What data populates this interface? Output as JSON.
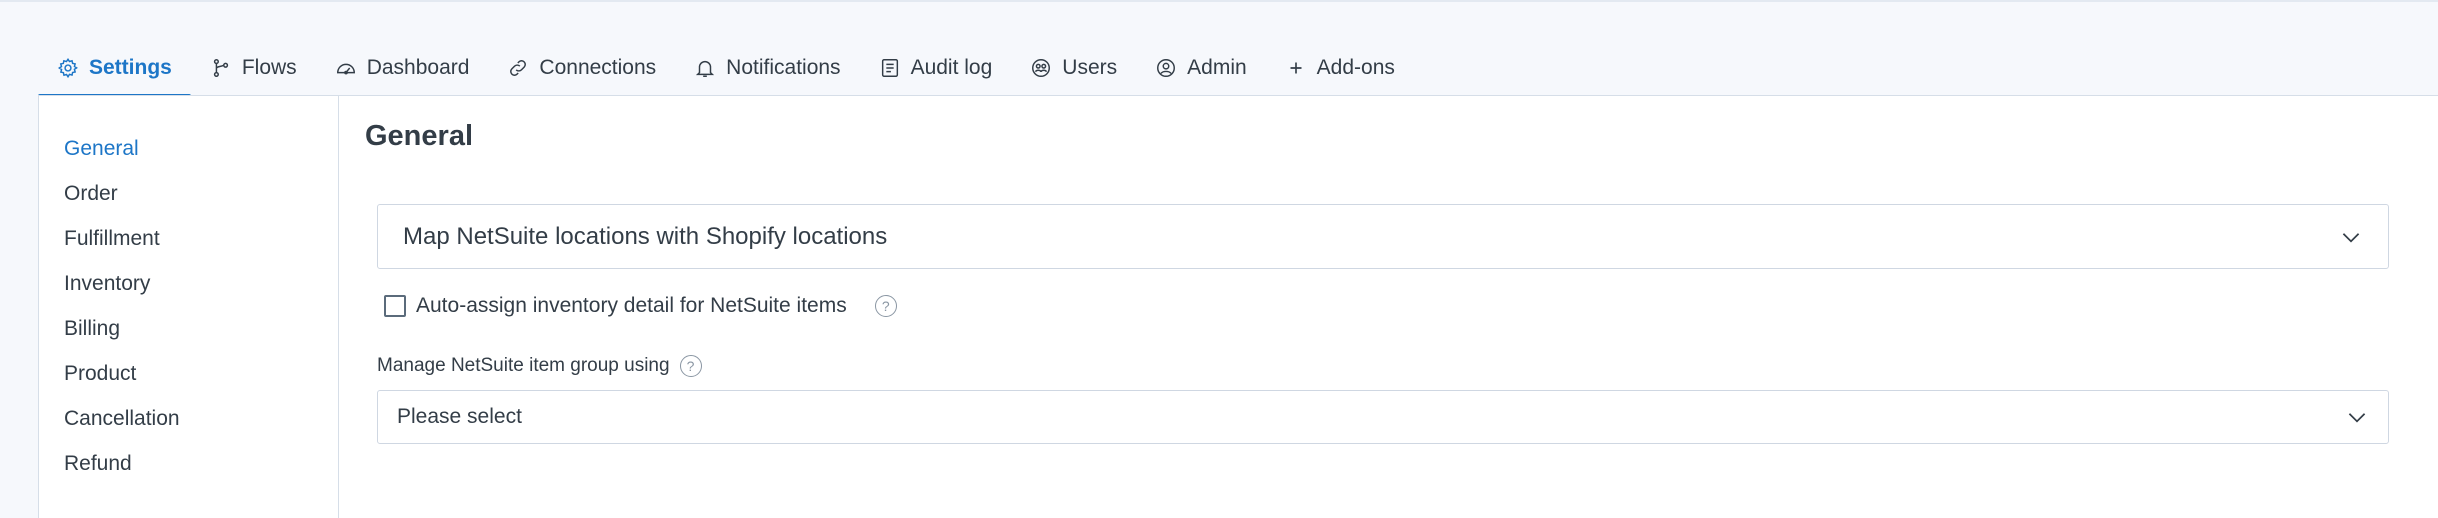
{
  "tabs": [
    {
      "label": "Settings",
      "icon": "gear-icon",
      "active": true
    },
    {
      "label": "Flows",
      "icon": "flow-icon",
      "active": false
    },
    {
      "label": "Dashboard",
      "icon": "dashboard-icon",
      "active": false
    },
    {
      "label": "Connections",
      "icon": "link-icon",
      "active": false
    },
    {
      "label": "Notifications",
      "icon": "bell-icon",
      "active": false
    },
    {
      "label": "Audit log",
      "icon": "audit-log-icon",
      "active": false
    },
    {
      "label": "Users",
      "icon": "users-icon",
      "active": false
    },
    {
      "label": "Admin",
      "icon": "admin-user-icon",
      "active": false
    },
    {
      "label": "Add-ons",
      "icon": "plus-icon",
      "active": false
    }
  ],
  "sidebar": {
    "items": [
      {
        "label": "General",
        "active": true
      },
      {
        "label": "Order",
        "active": false
      },
      {
        "label": "Fulfillment",
        "active": false
      },
      {
        "label": "Inventory",
        "active": false
      },
      {
        "label": "Billing",
        "active": false
      },
      {
        "label": "Product",
        "active": false
      },
      {
        "label": "Cancellation",
        "active": false
      },
      {
        "label": "Refund",
        "active": false
      }
    ]
  },
  "main": {
    "title": "General",
    "accordion": {
      "label": "Map NetSuite locations with Shopify locations"
    },
    "auto_assign": {
      "label": "Auto-assign inventory detail for NetSuite items",
      "checked": false,
      "help": "?"
    },
    "item_group": {
      "label": "Manage NetSuite item group using",
      "help": "?",
      "value": "Please select"
    }
  },
  "colors": {
    "accent": "#1d76c7",
    "text": "#333d47",
    "border": "#cfd7e2",
    "background": "#f6f8fc"
  }
}
